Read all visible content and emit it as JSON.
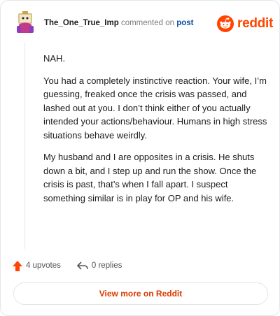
{
  "header": {
    "username": "The_One_True_Imp",
    "action_text": "commented on",
    "post_link": "post",
    "brand": "reddit"
  },
  "comment": {
    "paragraphs": [
      "NAH.",
      "You had a completely instinctive reaction. Your wife, I’m guessing, freaked once the crisis was passed, and lashed out at you. I don’t think either of you actually intended your actions/behaviour. Humans in high stress situations behave weirdly.",
      "My husband and I are opposites in a crisis. He shuts down a bit, and I step up and run the show. Once the crisis is past, that’s when I fall apart. I suspect something similar is in play for OP and his wife."
    ]
  },
  "actions": {
    "upvotes": "4 upvotes",
    "replies": "0 replies"
  },
  "footer": {
    "view_more": "View more on Reddit"
  },
  "icons": {
    "avatar": "avatar-icon",
    "logo": "reddit-alien-icon",
    "upvote": "upvote-arrow-icon",
    "reply": "reply-arrow-icon"
  },
  "colors": {
    "brand": "#ff4500",
    "link": "#0a4fa6",
    "upvote": "#ff4500",
    "view_more": "#d93a00"
  }
}
